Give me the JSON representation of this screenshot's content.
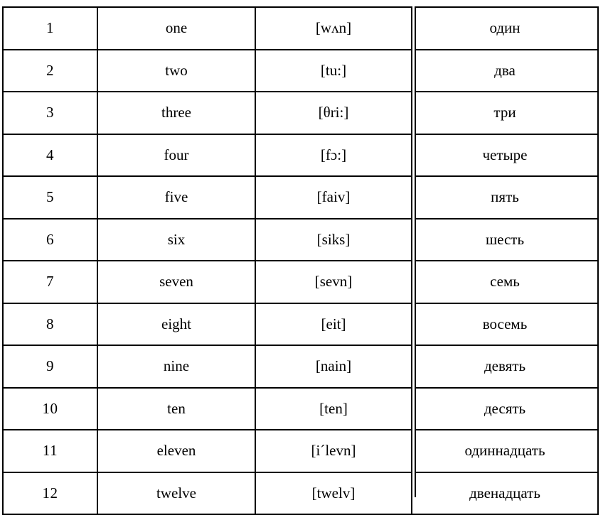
{
  "document": {
    "kind": "numerals-reference-table",
    "language_pair": "English – Russian",
    "row_count": 12,
    "column_count": 4
  },
  "table": {
    "columns": [
      {
        "key": "index",
        "name": "number-column"
      },
      {
        "key": "english",
        "name": "english-word-column"
      },
      {
        "key": "ipa",
        "name": "transcription-column"
      },
      {
        "key": "russian",
        "name": "russian-word-column"
      }
    ],
    "rows": [
      {
        "index": "1",
        "english": "one",
        "ipa": "[wʌn]",
        "russian": "один"
      },
      {
        "index": "2",
        "english": "two",
        "ipa": "[tu:]",
        "russian": "два"
      },
      {
        "index": "3",
        "english": "three",
        "ipa": "[θri:]",
        "russian": "три"
      },
      {
        "index": "4",
        "english": "four",
        "ipa": "[fɔ:]",
        "russian": "четыре"
      },
      {
        "index": "5",
        "english": "five",
        "ipa": "[faiv]",
        "russian": "пять"
      },
      {
        "index": "6",
        "english": "six",
        "ipa": "[siks]",
        "russian": "шесть"
      },
      {
        "index": "7",
        "english": "seven",
        "ipa": "[sevn]",
        "russian": "семь"
      },
      {
        "index": "8",
        "english": "eight",
        "ipa": "[eit]",
        "russian": "восемь"
      },
      {
        "index": "9",
        "english": "nine",
        "ipa": "[nain]",
        "russian": "девять"
      },
      {
        "index": "10",
        "english": "ten",
        "ipa": "[ten]",
        "russian": "десять"
      },
      {
        "index": "11",
        "english": "eleven",
        "ipa": "[i´levn]",
        "russian": "одиннадцать"
      },
      {
        "index": "12",
        "english": "twelve",
        "ipa": "[twelv]",
        "russian": "двенадцать"
      }
    ]
  },
  "style": {
    "border_color": "#000000",
    "text_color": "#000000",
    "background": "#ffffff"
  }
}
